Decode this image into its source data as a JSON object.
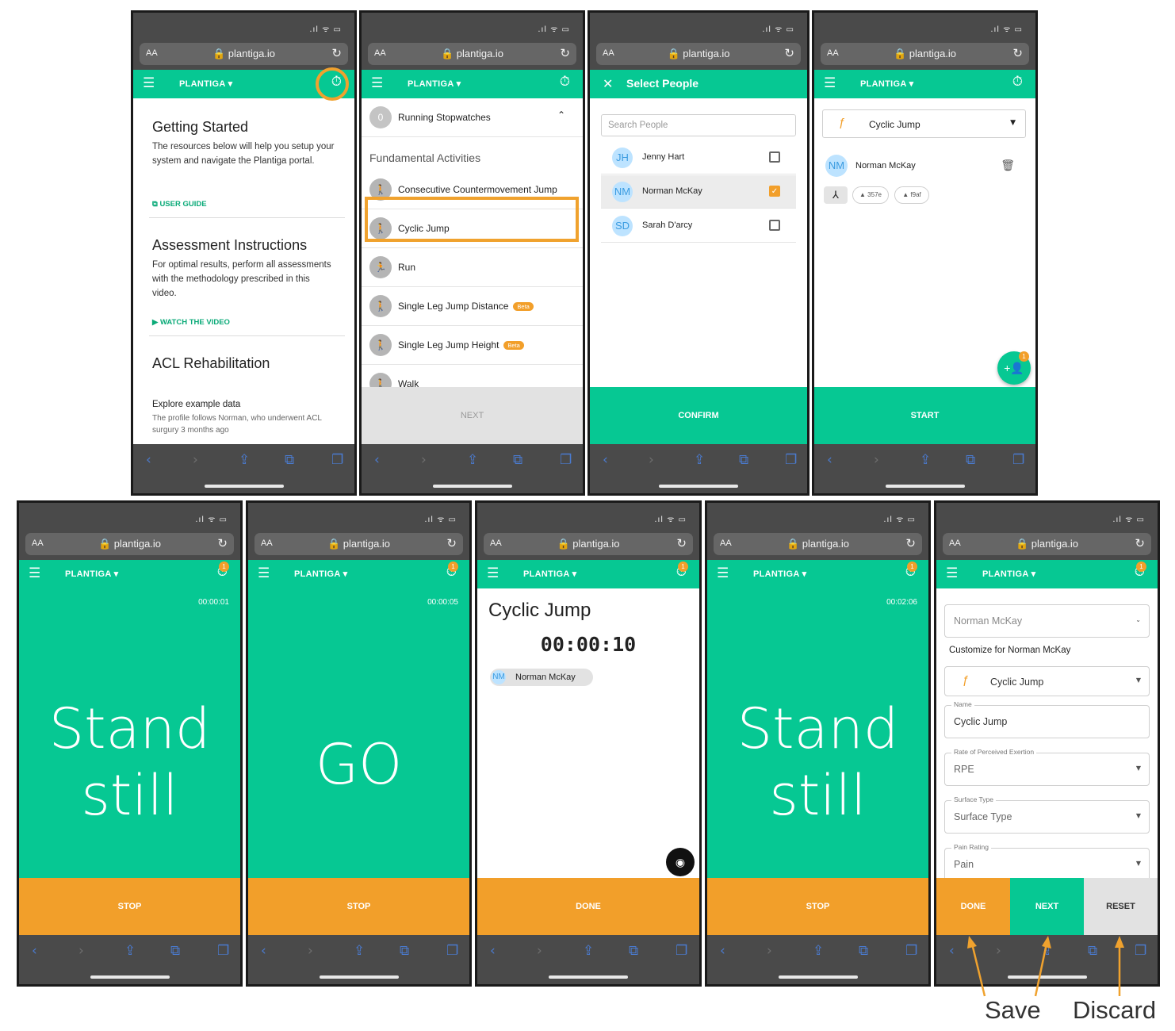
{
  "browser": {
    "url": "plantiga.io",
    "aa": "AA",
    "reload_icon": "reload-icon",
    "nav_icons": [
      "back-icon",
      "forward-icon",
      "share-icon",
      "bookmarks-icon",
      "tabs-icon"
    ]
  },
  "app": {
    "brand": "PLANTIGA",
    "timer_badge": "1"
  },
  "screen1": {
    "section1_title": "Getting Started",
    "section1_text": "The resources below will help you setup your system and navigate the Plantiga portal.",
    "section1_link": "USER GUIDE",
    "section2_title": "Assessment Instructions",
    "section2_text": "For optimal results, perform all assessments with the methodology prescribed in this video.",
    "section2_link": "WATCH THE VIDEO",
    "section3_title": "ACL Rehabilitation",
    "section3_sub": "Explore example data",
    "section3_text": "The profile follows Norman, who underwent ACL surgury 3 months ago"
  },
  "screen2": {
    "running_count": "0",
    "running_label": "Running Stopwatches",
    "section_title": "Fundamental Activities",
    "activities": [
      {
        "label": "Consecutive Countermovement Jump",
        "beta": ""
      },
      {
        "label": "Cyclic Jump",
        "beta": ""
      },
      {
        "label": "Run",
        "beta": ""
      },
      {
        "label": "Single Leg Jump Distance",
        "beta": "Beta"
      },
      {
        "label": "Single Leg Jump Height",
        "beta": "Beta"
      },
      {
        "label": "Walk",
        "beta": ""
      }
    ],
    "next_label": "NEXT"
  },
  "screen3": {
    "title": "Select People",
    "search_placeholder": "Search People",
    "people": [
      {
        "initials": "JH",
        "name": "Jenny Hart",
        "checked": false
      },
      {
        "initials": "NM",
        "name": "Norman McKay",
        "checked": true
      },
      {
        "initials": "SD",
        "name": "Sarah D'arcy",
        "checked": false
      }
    ],
    "confirm_label": "CONFIRM"
  },
  "screen4": {
    "activity": "Cyclic Jump",
    "person_initials": "NM",
    "person_name": "Norman McKay",
    "pods": [
      "357e",
      "f9af"
    ],
    "fab_badge": "1",
    "start_label": "START"
  },
  "screen5": {
    "elapsed": "00:00:01",
    "prompt_line1": "Stand",
    "prompt_line2": "still",
    "stop_label": "STOP"
  },
  "screen6": {
    "elapsed": "00:00:05",
    "prompt": "GO",
    "stop_label": "STOP"
  },
  "screen7": {
    "title": "Cyclic Jump",
    "clock": "00:00:10",
    "person_initials": "NM",
    "person_name": "Norman McKay",
    "done_label": "DONE"
  },
  "screen8": {
    "elapsed": "00:02:06",
    "prompt_line1": "Stand",
    "prompt_line2": "still",
    "stop_label": "STOP"
  },
  "screen9": {
    "person_select": "Norman McKay",
    "customize_label": "Customize for Norman McKay",
    "activity": "Cyclic Jump",
    "name_label": "Name",
    "name_value": "Cyclic Jump",
    "rpe_label": "Rate of Perceived Exertion",
    "rpe_value": "RPE",
    "surface_label": "Surface Type",
    "surface_value": "Surface Type",
    "pain_label": "Pain Rating",
    "pain_value": "Pain",
    "done_label": "DONE",
    "next_label": "NEXT",
    "reset_label": "RESET"
  },
  "annotations": {
    "save": "Save",
    "discard": "Discard"
  },
  "colors": {
    "primary_green": "#06c893",
    "accent_orange": "#f29f2a",
    "highlight_outline": "#f0a22e"
  }
}
